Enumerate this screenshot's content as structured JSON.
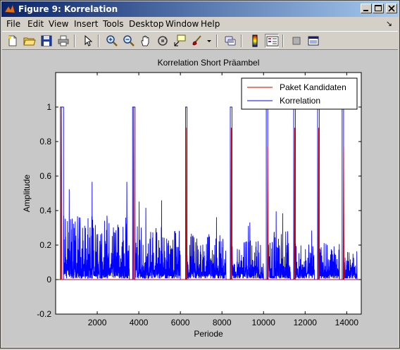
{
  "window": {
    "title": "Figure 9: Korrelation",
    "buttons": [
      "minimize-button",
      "maximize-button",
      "close-button"
    ]
  },
  "menu": {
    "items": [
      "File",
      "Edit",
      "View",
      "Insert",
      "Tools",
      "Desktop",
      "Window",
      "Help"
    ],
    "dock_arrow": "↘"
  },
  "toolbar": {
    "icons": [
      "new-file-icon",
      "open-folder-icon",
      "save-icon",
      "print-icon",
      "arrow-select-icon",
      "zoom-in-icon",
      "zoom-out-icon",
      "pan-hand-icon",
      "rotate-3d-icon",
      "data-cursor-icon",
      "brush-icon",
      "link-icon",
      "colorbar-icon",
      "legend-icon",
      "hide-plot-tools-icon",
      "show-plot-tools-icon"
    ]
  },
  "chart_data": {
    "type": "line",
    "title": "Korrelation Short Präambel",
    "xlabel": "Periode",
    "ylabel": "Amplitude",
    "xlim": [
      0,
      14700
    ],
    "ylim": [
      -0.2,
      1.2
    ],
    "xticks": [
      2000,
      4000,
      6000,
      8000,
      10000,
      12000,
      14000
    ],
    "xtick_labels": [
      "2000",
      "4000",
      "6000",
      "8000",
      "10000",
      "12000",
      "14000"
    ],
    "yticks": [
      -0.2,
      0,
      0.2,
      0.4,
      0.6,
      0.8,
      1
    ],
    "ytick_labels": [
      "-0.2",
      "0",
      "0.2",
      "0.4",
      "0.6",
      "0.8",
      "1"
    ],
    "legend": {
      "placement": "top-right",
      "entries": [
        "Paket Kandidaten",
        "Korrelation"
      ]
    },
    "series": [
      {
        "name": "Paket Kandidaten",
        "color": "#cc0000",
        "baseline": 0,
        "spikes": [
          {
            "x": 280,
            "y": 1.0
          },
          {
            "x": 3750,
            "y": 1.0
          },
          {
            "x": 6300,
            "y": 0.88
          },
          {
            "x": 8450,
            "y": 0.88
          },
          {
            "x": 10200,
            "y": 0.77
          },
          {
            "x": 11500,
            "y": 0.88
          },
          {
            "x": 12650,
            "y": 0.88
          },
          {
            "x": 13850,
            "y": 0.77
          }
        ]
      },
      {
        "name": "Korrelation",
        "color": "#0000ff",
        "plateaus": [
          {
            "x0": 230,
            "x1": 380,
            "y": 1.0
          },
          {
            "x0": 3700,
            "x1": 3820,
            "y": 1.0
          },
          {
            "x0": 6250,
            "x1": 6320,
            "y": 1.0
          },
          {
            "x0": 8400,
            "x1": 8480,
            "y": 1.0
          },
          {
            "x0": 10130,
            "x1": 10200,
            "y": 1.0
          },
          {
            "x0": 11450,
            "x1": 11530,
            "y": 1.0
          },
          {
            "x0": 12600,
            "x1": 12680,
            "y": 1.0
          },
          {
            "x0": 13780,
            "x1": 13850,
            "y": 1.0
          }
        ],
        "noise_bursts": [
          {
            "x0": 380,
            "x1": 3550,
            "peak": 0.57
          },
          {
            "x0": 3820,
            "x1": 6000,
            "peak": 0.47
          },
          {
            "x0": 6320,
            "x1": 8200,
            "peak": 0.4
          },
          {
            "x0": 8480,
            "x1": 10000,
            "peak": 0.34
          },
          {
            "x0": 10200,
            "x1": 11300,
            "peak": 0.42
          },
          {
            "x0": 11530,
            "x1": 12450,
            "peak": 0.32
          },
          {
            "x0": 12680,
            "x1": 13650,
            "peak": 0.31
          },
          {
            "x0": 13850,
            "x1": 14500,
            "peak": 0.24
          }
        ]
      }
    ],
    "background": "#ffffff",
    "grid": false
  }
}
